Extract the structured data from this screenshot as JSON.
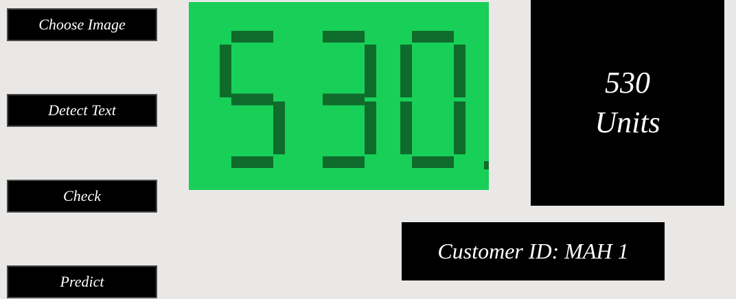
{
  "buttons": {
    "choose_image": "Choose Image",
    "detect_text": "Detect Text",
    "check": "Check",
    "predict": "Predict"
  },
  "meter_display": {
    "digits": "530",
    "background_color": "#18cf58",
    "segment_color": "#0f6b2c"
  },
  "result": {
    "value": "530",
    "unit": "Units"
  },
  "customer": {
    "label": "Customer ID: MAH 1"
  }
}
